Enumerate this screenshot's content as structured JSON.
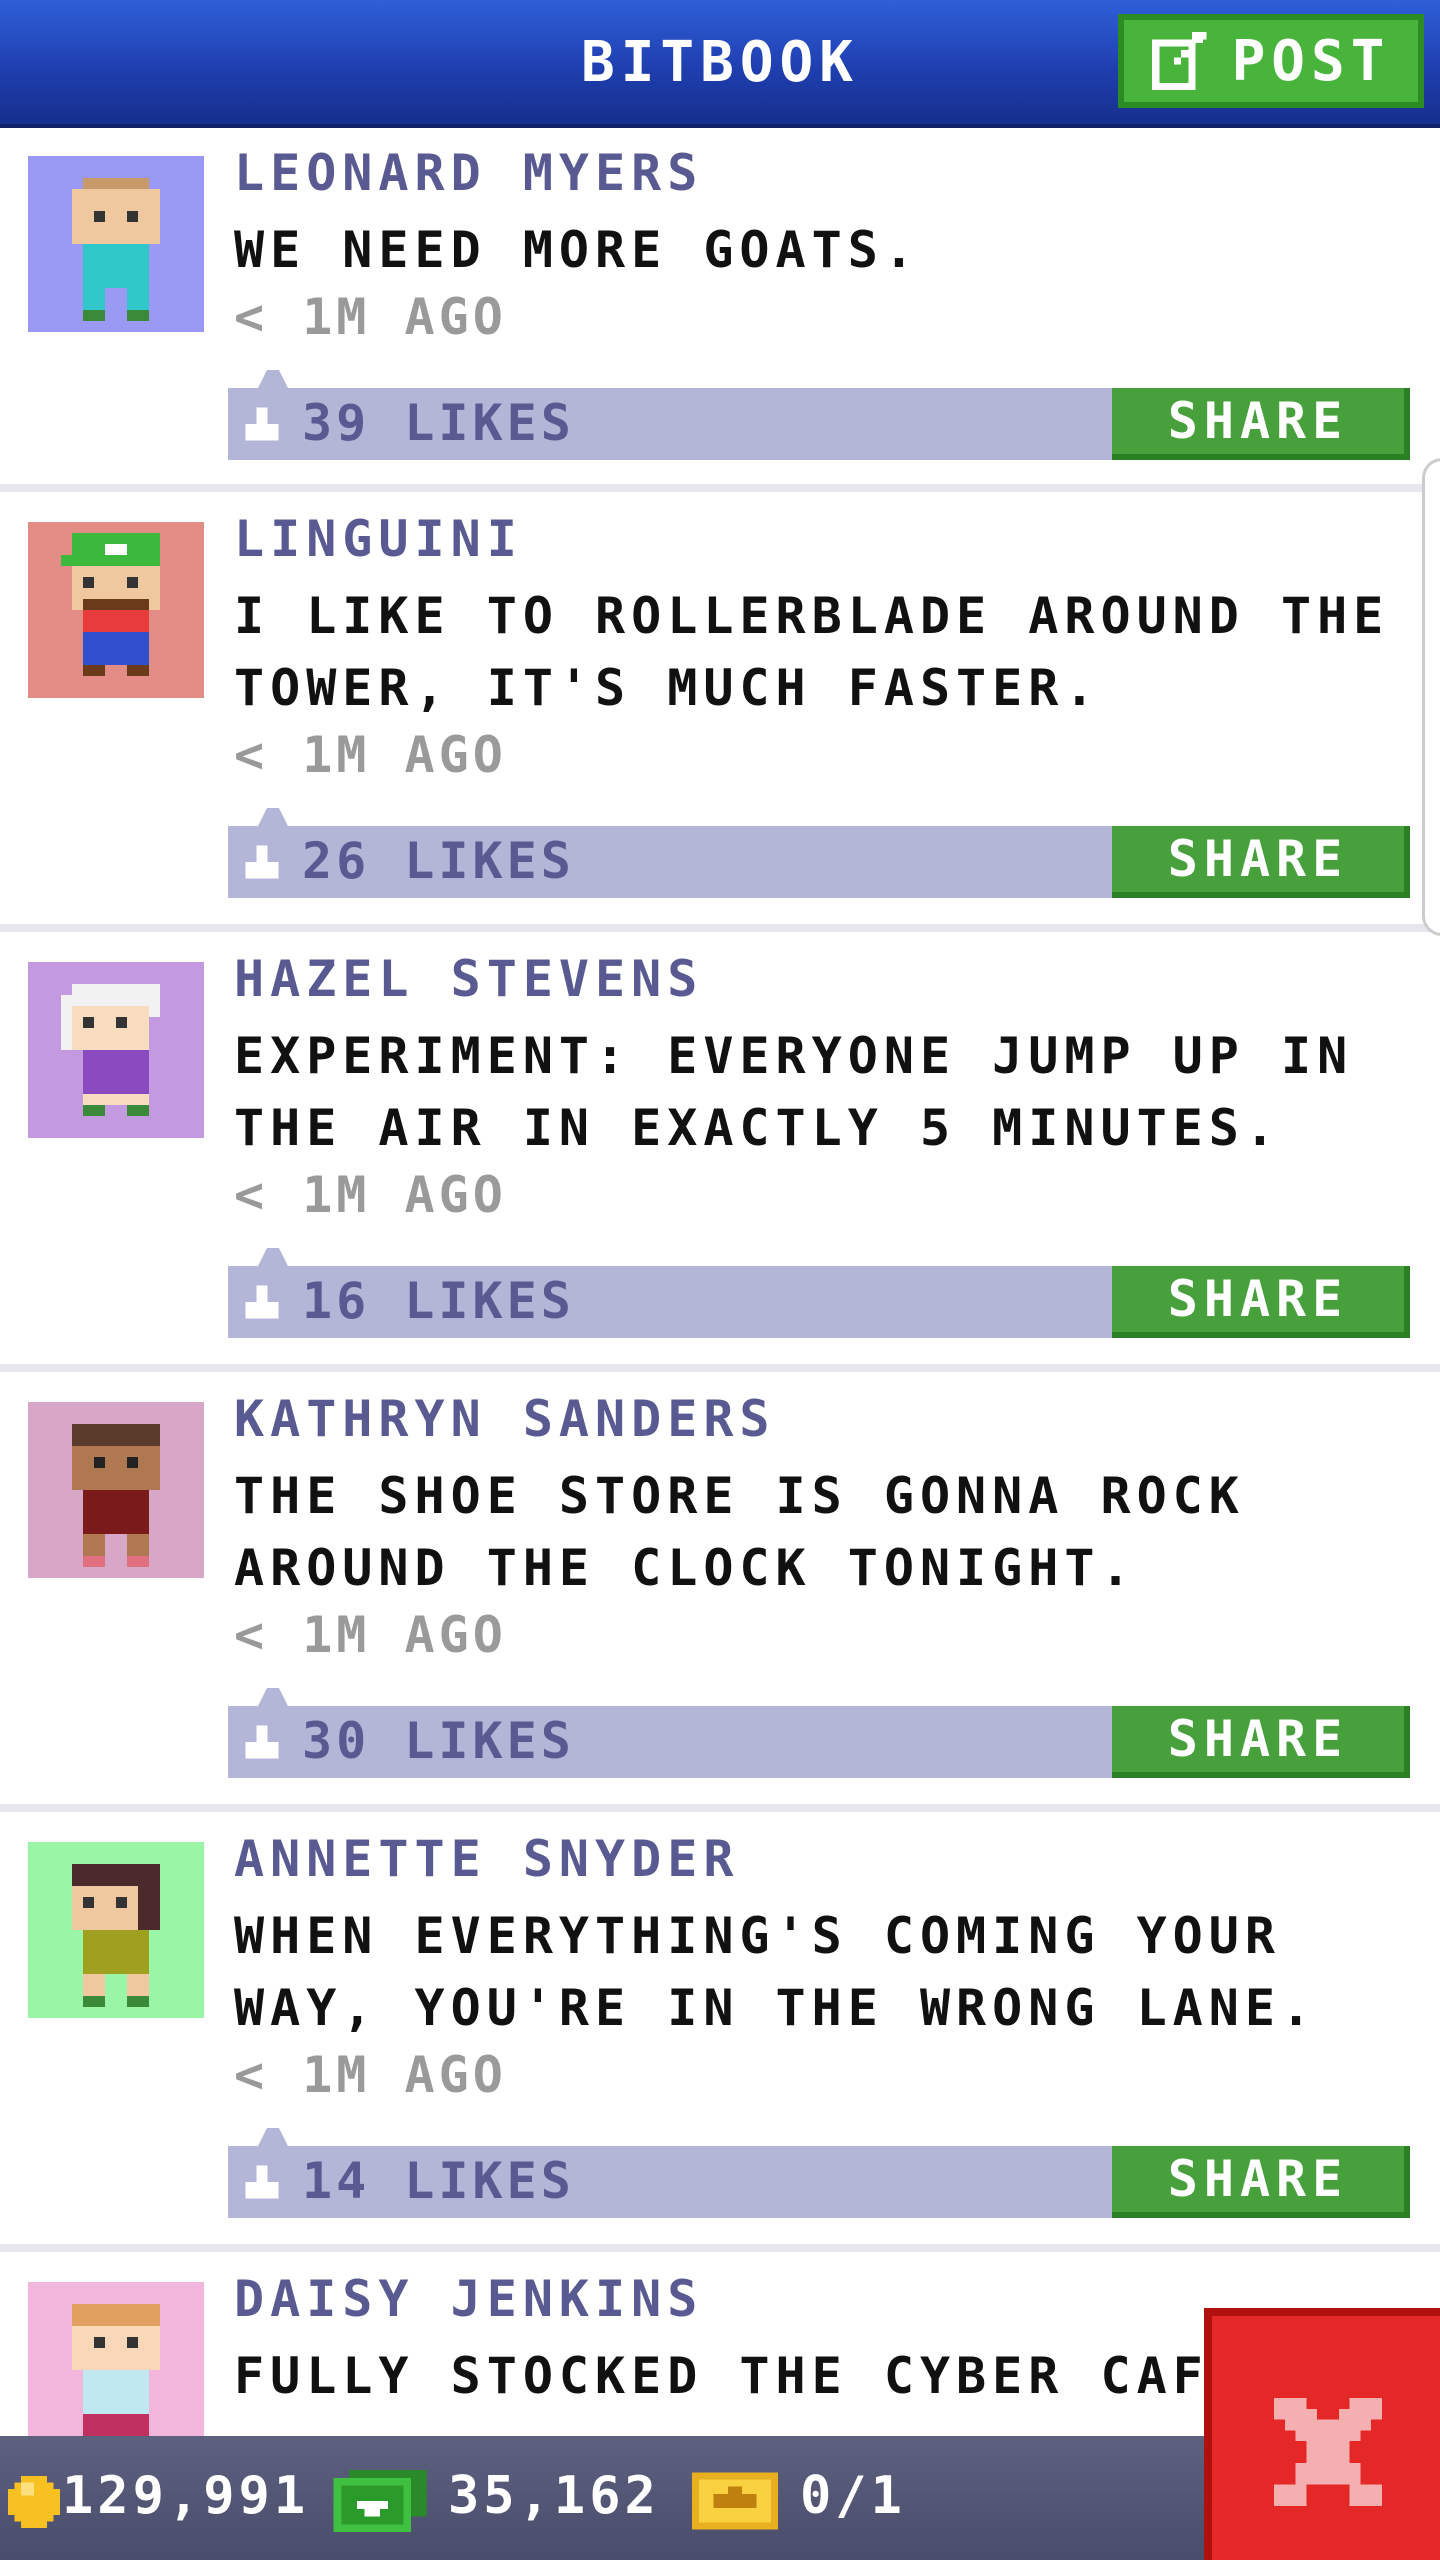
{
  "header": {
    "title": "BITBOOK",
    "post_label": "POST",
    "post_icon": "edit-icon"
  },
  "posts": [
    {
      "name": "LEONARD MYERS",
      "message": "WE NEED MORE GOATS.",
      "time": "< 1M AGO",
      "likes": "39 LIKES",
      "share": "SHARE",
      "avatar_bg": "#9a9af5"
    },
    {
      "name": "LINGUINI",
      "message": "I LIKE TO ROLLERBLADE AROUND THE TOWER, IT'S MUCH FASTER.",
      "time": "< 1M AGO",
      "likes": "26 LIKES",
      "share": "SHARE",
      "avatar_bg": "#e38c86"
    },
    {
      "name": "HAZEL STEVENS",
      "message": "EXPERIMENT: EVERYONE JUMP UP IN THE AIR IN EXACTLY 5 MINUTES.",
      "time": "< 1M AGO",
      "likes": "16 LIKES",
      "share": "SHARE",
      "avatar_bg": "#c39ae0"
    },
    {
      "name": "KATHRYN SANDERS",
      "message": "THE SHOE STORE IS GONNA ROCK AROUND THE CLOCK TONIGHT.",
      "time": "< 1M AGO",
      "likes": "30 LIKES",
      "share": "SHARE",
      "avatar_bg": "#d8a6c6"
    },
    {
      "name": "ANNETTE SNYDER",
      "message": "WHEN EVERYTHING'S COMING YOUR WAY, YOU'RE IN THE WRONG LANE.",
      "time": "< 1M AGO",
      "likes": "14 LIKES",
      "share": "SHARE",
      "avatar_bg": "#9af5a6"
    },
    {
      "name": "DAISY JENKINS",
      "message": "FULLY STOCKED THE CYBER CAFE",
      "time": "",
      "likes": "",
      "share": "",
      "avatar_bg": "#f2b6dc"
    }
  ],
  "footer": {
    "coins": "129,991",
    "bux": "35,162",
    "tickets": "0/1"
  },
  "colors": {
    "header_blue": "#1f3fb0",
    "post_green": "#48b43c",
    "likes_bar": "#b4b6d8",
    "close_red": "#e42828"
  }
}
